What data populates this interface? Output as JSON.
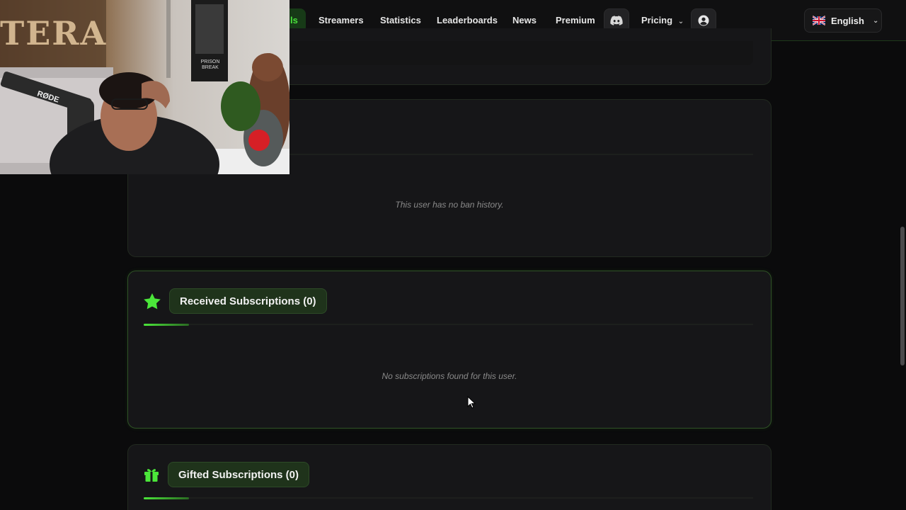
{
  "nav": {
    "active_label": "ls",
    "items": [
      "Streamers",
      "Statistics",
      "Leaderboards",
      "News",
      "Premium"
    ],
    "pricing_label": "Pricing",
    "language_label": "English",
    "icons": {
      "discord": "discord-icon",
      "account": "user-circle-icon",
      "flag": "uk-flag-icon",
      "chevron": "chevron-down-icon"
    }
  },
  "ban_history": {
    "empty_text": "This user has no ban history."
  },
  "received_subscriptions": {
    "title": "Received Subscriptions (0)",
    "icon": "star-icon",
    "empty_text": "No subscriptions found for this user."
  },
  "gifted_subscriptions": {
    "title": "Gifted Subscriptions (0)",
    "icon": "gift-icon"
  },
  "webcam": {
    "sign_text": "TERA",
    "mic_brand": "RØDE",
    "poster_text": "PRISON BREAK"
  },
  "colors": {
    "accent": "#4be63a",
    "background": "#0b0b0c",
    "card": "#161618",
    "pill": "#1f331b"
  }
}
